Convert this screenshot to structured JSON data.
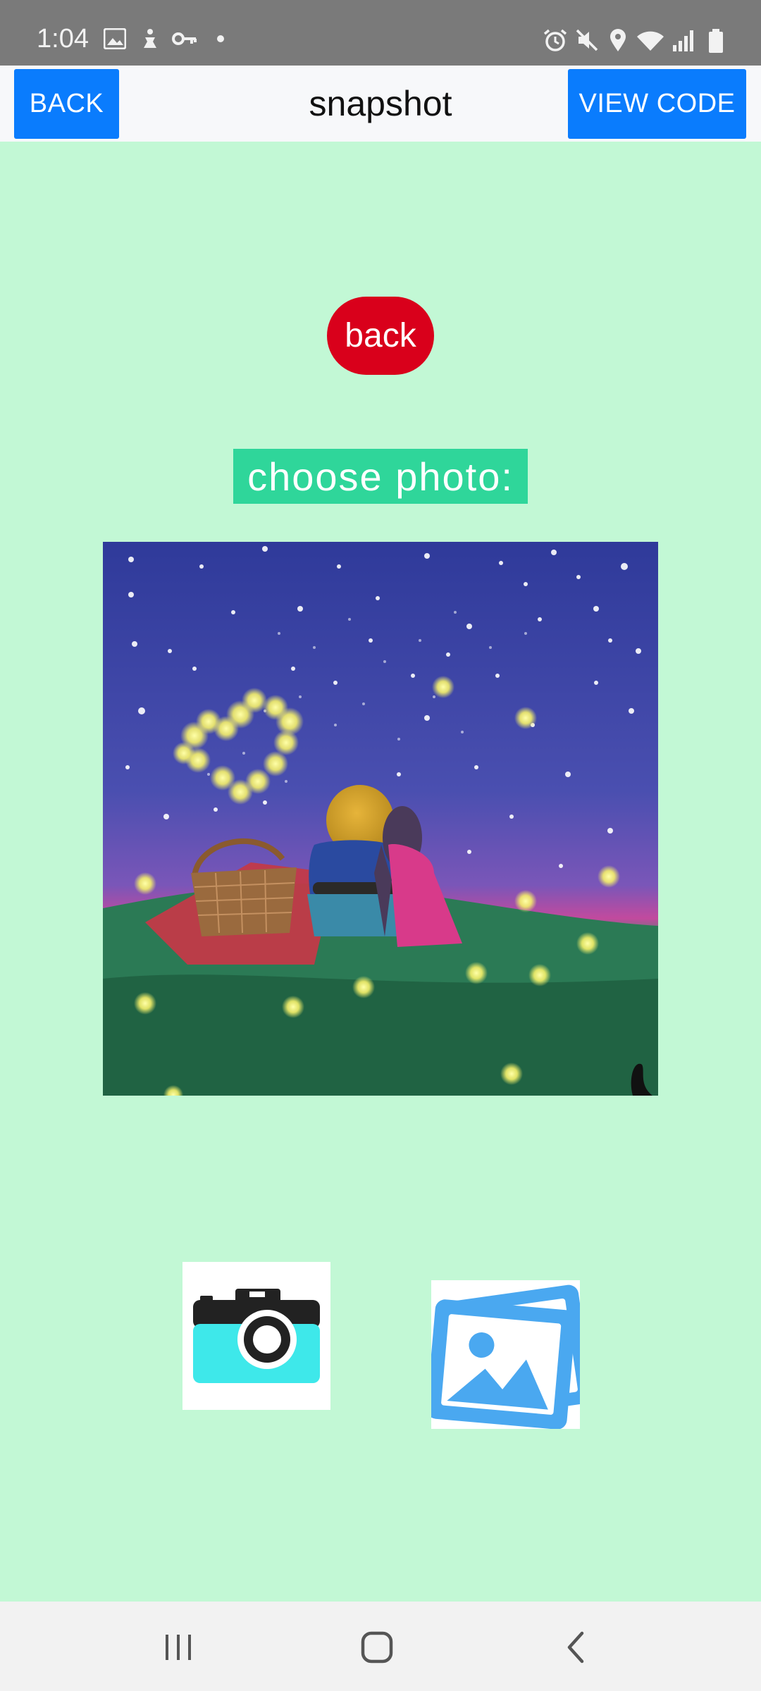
{
  "status_bar": {
    "time": "1:04",
    "left_icons": [
      "image-icon",
      "accessibility-icon",
      "key-icon",
      "dot-icon"
    ],
    "right_icons": [
      "alarm-icon",
      "mute-icon",
      "location-icon",
      "wifi-icon",
      "signal-icon",
      "battery-icon"
    ]
  },
  "app_bar": {
    "back_label": "BACK",
    "title": "snapshot",
    "view_code_label": "VIEW CODE"
  },
  "main": {
    "back_button_label": "back",
    "choose_label": "choose photo:",
    "photo_description_icon": "picture-couple-under-stars",
    "camera_icon": "camera-icon",
    "gallery_icon": "gallery-icon"
  },
  "nav_bar": {
    "icons": [
      "recents-icon",
      "home-icon",
      "back-icon"
    ]
  },
  "colors": {
    "background": "#c2f8d5",
    "primary_button": "#0a7cfd",
    "back_pill": "#d9001b",
    "choose_label_bg": "#2fd69a",
    "camera_accent": "#3ee8ea",
    "gallery_accent": "#4aa8f0"
  }
}
